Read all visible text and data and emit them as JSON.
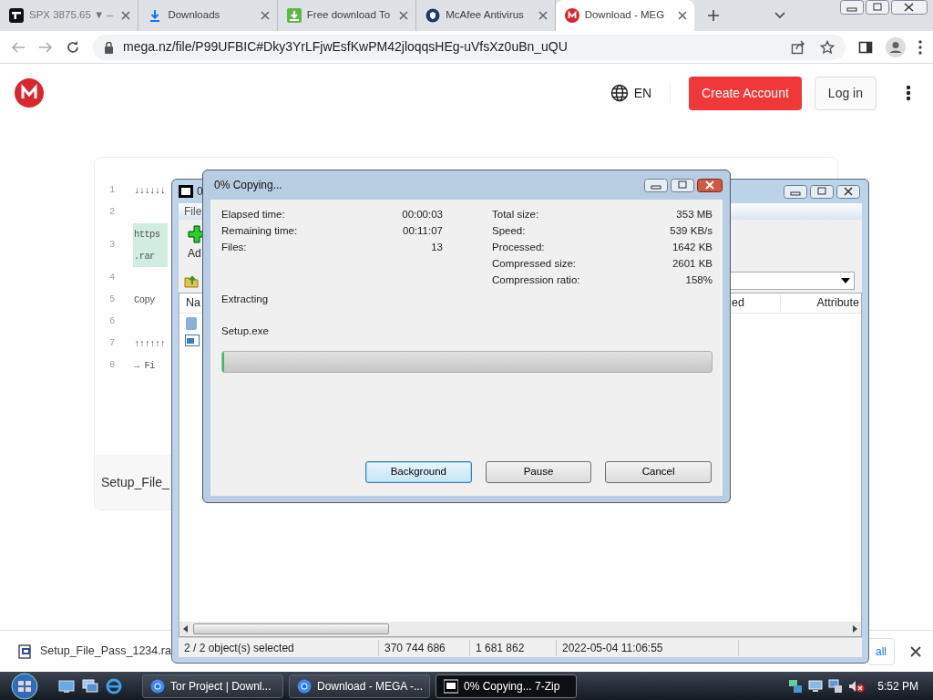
{
  "browser": {
    "tabs": [
      {
        "kind": "chart",
        "label": "SPX 3875.65 ▼ –",
        "selected": false
      },
      {
        "kind": "download",
        "label": "Downloads",
        "selected": false
      },
      {
        "kind": "install",
        "label": "Free download To",
        "selected": false
      },
      {
        "kind": "shield",
        "label": "McAfee Antivirus",
        "selected": false
      },
      {
        "kind": "mega",
        "label": "Download - MEG",
        "selected": true
      }
    ],
    "url": "mega.nz/file/P99UFBIC#Dky3YrLFjwEsfKwPM42jloqqsHEg-uVfsXz0uBn_uQU"
  },
  "site": {
    "language": "EN",
    "create_account": "Create Account",
    "log_in": "Log in",
    "code_lines": [
      {
        "number": "1",
        "text": [
          "↓↓↓↓↓↓"
        ],
        "highlighted": false
      },
      {
        "number": "2"
      },
      {
        "number": "3",
        "text": [
          "https",
          ".rar"
        ],
        "highlighted": true
      },
      {
        "number": "4"
      },
      {
        "number": "5",
        "text": [
          "Copy"
        ],
        "highlighted": false
      },
      {
        "number": "6"
      },
      {
        "number": "7",
        "text": [
          "↑↑↑↑↑↑"
        ],
        "highlighted": false
      },
      {
        "number": "8",
        "text": [
          "→ Fi"
        ],
        "highlighted": false
      }
    ],
    "file_title": "Setup_File_"
  },
  "archiver": {
    "title": "0",
    "menu": [
      "File"
    ],
    "toolbar": [
      "Ad"
    ],
    "columns": [
      "Na",
      "ed",
      "Attribute"
    ],
    "status_bar": [
      "2 / 2 object(s) selected",
      "370 744 686",
      "1 681 862",
      "2022-05-04 11:06:55"
    ]
  },
  "progress_dialog": {
    "title": "0% Copying...",
    "stats_left": [
      {
        "label": "Elapsed time:",
        "value": "00:00:03"
      },
      {
        "label": "Remaining time:",
        "value": "00:11:07"
      },
      {
        "label": "Files:",
        "value": "13"
      }
    ],
    "stats_right": [
      {
        "label": "Total size:",
        "value": "353 MB"
      },
      {
        "label": "Speed:",
        "value": "539 KB/s"
      },
      {
        "label": "Processed:",
        "value": "1642 KB"
      },
      {
        "label": "Compressed size:",
        "value": "2601 KB"
      },
      {
        "label": "Compression ratio:",
        "value": "158%"
      }
    ],
    "operation": "Extracting",
    "current_file": "Setup.exe",
    "level": 0.004,
    "buttons": [
      {
        "label": "Background",
        "selected": true
      },
      {
        "label": "Pause",
        "selected": false
      },
      {
        "label": "Cancel",
        "selected": false
      }
    ]
  },
  "downloads_bar": {
    "file": "Setup_File_Pass_1234.ra",
    "show_all": "all"
  },
  "taskbar": {
    "tasks": [
      {
        "kind": "chrome",
        "label": "Tor Project | Downl...",
        "selected": false
      },
      {
        "kind": "chrome",
        "label": "Download - MEGA -...",
        "selected": false
      },
      {
        "kind": "archive",
        "label": "0% Copying... 7-Zip",
        "selected": true
      }
    ],
    "clock": "5:52 PM"
  }
}
